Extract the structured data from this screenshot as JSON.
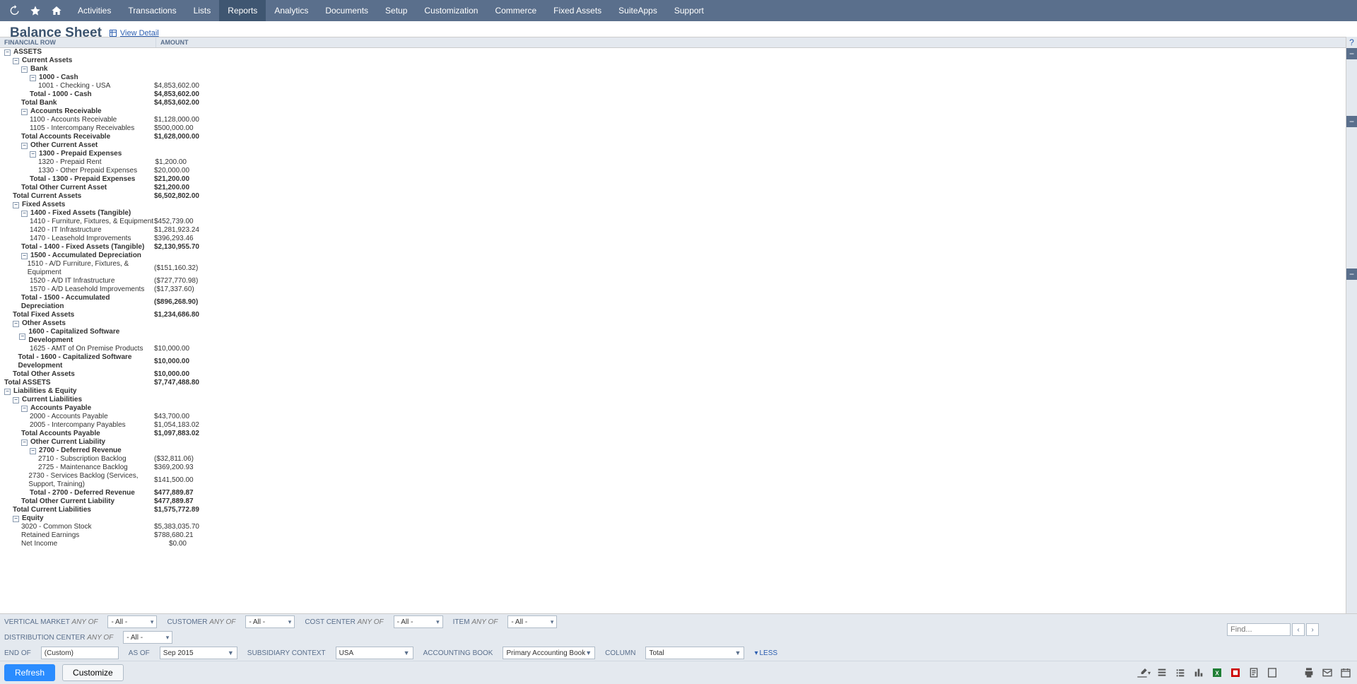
{
  "nav": {
    "items": [
      "Activities",
      "Transactions",
      "Lists",
      "Reports",
      "Analytics",
      "Documents",
      "Setup",
      "Customization",
      "Commerce",
      "Fixed Assets",
      "SuiteApps",
      "Support"
    ],
    "active_index": 3
  },
  "title": {
    "heading": "Balance Sheet",
    "view_detail": "View Detail"
  },
  "columns": {
    "name": "FINANCIAL ROW",
    "amount": "AMOUNT"
  },
  "rows": [
    {
      "depth": 0,
      "toggle": "-",
      "bold": true,
      "label": "ASSETS",
      "amt": ""
    },
    {
      "depth": 1,
      "toggle": "-",
      "bold": true,
      "label": "Current Assets",
      "amt": ""
    },
    {
      "depth": 2,
      "toggle": "-",
      "bold": true,
      "label": "Bank",
      "amt": ""
    },
    {
      "depth": 3,
      "toggle": "-",
      "bold": true,
      "label": "1000 - Cash",
      "amt": ""
    },
    {
      "depth": 4,
      "toggle": "",
      "bold": false,
      "label": "1001 - Checking - USA",
      "amt": "$4,853,602.00"
    },
    {
      "depth": 3,
      "toggle": "",
      "bold": true,
      "label": "Total - 1000 - Cash",
      "amt": "$4,853,602.00"
    },
    {
      "depth": 2,
      "toggle": "",
      "bold": true,
      "label": "Total Bank",
      "amt": "$4,853,602.00"
    },
    {
      "depth": 2,
      "toggle": "-",
      "bold": true,
      "label": "Accounts Receivable",
      "amt": ""
    },
    {
      "depth": 3,
      "toggle": "",
      "bold": false,
      "label": "1100 - Accounts Receivable",
      "amt": "$1,128,000.00"
    },
    {
      "depth": 3,
      "toggle": "",
      "bold": false,
      "label": "1105 - Intercompany Receivables",
      "amt": "$500,000.00"
    },
    {
      "depth": 2,
      "toggle": "",
      "bold": true,
      "label": "Total Accounts Receivable",
      "amt": "$1,628,000.00"
    },
    {
      "depth": 2,
      "toggle": "-",
      "bold": true,
      "label": "Other Current Asset",
      "amt": ""
    },
    {
      "depth": 3,
      "toggle": "-",
      "bold": true,
      "label": "1300 - Prepaid Expenses",
      "amt": ""
    },
    {
      "depth": 4,
      "toggle": "",
      "bold": false,
      "label": "1320 - Prepaid Rent",
      "amt": "$1,200.00"
    },
    {
      "depth": 4,
      "toggle": "",
      "bold": false,
      "label": "1330 - Other Prepaid Expenses",
      "amt": "$20,000.00"
    },
    {
      "depth": 3,
      "toggle": "",
      "bold": true,
      "label": "Total - 1300 - Prepaid Expenses",
      "amt": "$21,200.00"
    },
    {
      "depth": 2,
      "toggle": "",
      "bold": true,
      "label": "Total Other Current Asset",
      "amt": "$21,200.00"
    },
    {
      "depth": 1,
      "toggle": "",
      "bold": true,
      "label": "Total Current Assets",
      "amt": "$6,502,802.00"
    },
    {
      "depth": 1,
      "toggle": "-",
      "bold": true,
      "label": "Fixed Assets",
      "amt": ""
    },
    {
      "depth": 2,
      "toggle": "-",
      "bold": true,
      "label": "1400 - Fixed Assets (Tangible)",
      "amt": ""
    },
    {
      "depth": 3,
      "toggle": "",
      "bold": false,
      "label": "1410 - Furniture, Fixtures, & Equipment",
      "amt": "$452,739.00"
    },
    {
      "depth": 3,
      "toggle": "",
      "bold": false,
      "label": "1420 - IT Infrastructure",
      "amt": "$1,281,923.24"
    },
    {
      "depth": 3,
      "toggle": "",
      "bold": false,
      "label": "1470 - Leasehold Improvements",
      "amt": "$396,293.46"
    },
    {
      "depth": 2,
      "toggle": "",
      "bold": true,
      "label": "Total - 1400 - Fixed Assets (Tangible)",
      "amt": "$2,130,955.70"
    },
    {
      "depth": 2,
      "toggle": "-",
      "bold": true,
      "label": "1500 - Accumulated Depreciation",
      "amt": ""
    },
    {
      "depth": 3,
      "toggle": "",
      "bold": false,
      "label": "1510 - A/D Furniture, Fixtures, & Equipment",
      "amt": "($151,160.32)"
    },
    {
      "depth": 3,
      "toggle": "",
      "bold": false,
      "label": "1520 - A/D IT Infrastructure",
      "amt": "($727,770.98)"
    },
    {
      "depth": 3,
      "toggle": "",
      "bold": false,
      "label": "1570 - A/D Leasehold Improvements",
      "amt": "($17,337.60)"
    },
    {
      "depth": 2,
      "toggle": "",
      "bold": true,
      "label": "Total - 1500 - Accumulated Depreciation",
      "amt": "($896,268.90)"
    },
    {
      "depth": 1,
      "toggle": "",
      "bold": true,
      "label": "Total Fixed Assets",
      "amt": "$1,234,686.80"
    },
    {
      "depth": 1,
      "toggle": "-",
      "bold": true,
      "label": "Other Assets",
      "amt": ""
    },
    {
      "depth": 2,
      "toggle": "-",
      "bold": true,
      "label": "1600 - Capitalized Software Development",
      "amt": ""
    },
    {
      "depth": 3,
      "toggle": "",
      "bold": false,
      "label": "1625 - AMT of On Premise Products",
      "amt": "$10,000.00"
    },
    {
      "depth": 2,
      "toggle": "",
      "bold": true,
      "label": "Total - 1600 - Capitalized Software Development",
      "amt": "$10,000.00"
    },
    {
      "depth": 1,
      "toggle": "",
      "bold": true,
      "label": "Total Other Assets",
      "amt": "$10,000.00"
    },
    {
      "depth": 0,
      "toggle": "",
      "bold": true,
      "label": "Total ASSETS",
      "amt": "$7,747,488.80"
    },
    {
      "depth": 0,
      "toggle": "-",
      "bold": true,
      "label": "Liabilities & Equity",
      "amt": ""
    },
    {
      "depth": 1,
      "toggle": "-",
      "bold": true,
      "label": "Current Liabilities",
      "amt": ""
    },
    {
      "depth": 2,
      "toggle": "-",
      "bold": true,
      "label": "Accounts Payable",
      "amt": ""
    },
    {
      "depth": 3,
      "toggle": "",
      "bold": false,
      "label": "2000 - Accounts Payable",
      "amt": "$43,700.00"
    },
    {
      "depth": 3,
      "toggle": "",
      "bold": false,
      "label": "2005 - Intercompany Payables",
      "amt": "$1,054,183.02"
    },
    {
      "depth": 2,
      "toggle": "",
      "bold": true,
      "label": "Total Accounts Payable",
      "amt": "$1,097,883.02"
    },
    {
      "depth": 2,
      "toggle": "-",
      "bold": true,
      "label": "Other Current Liability",
      "amt": ""
    },
    {
      "depth": 3,
      "toggle": "-",
      "bold": true,
      "label": "2700 - Deferred Revenue",
      "amt": ""
    },
    {
      "depth": 4,
      "toggle": "",
      "bold": false,
      "label": "2710 - Subscription Backlog",
      "amt": "($32,811.06)"
    },
    {
      "depth": 4,
      "toggle": "",
      "bold": false,
      "label": "2725 - Maintenance Backlog",
      "amt": "$369,200.93"
    },
    {
      "depth": 4,
      "toggle": "",
      "bold": false,
      "label": "2730 - Services Backlog (Services, Support, Training)",
      "amt": "$141,500.00"
    },
    {
      "depth": 3,
      "toggle": "",
      "bold": true,
      "label": "Total - 2700 - Deferred Revenue",
      "amt": "$477,889.87"
    },
    {
      "depth": 2,
      "toggle": "",
      "bold": true,
      "label": "Total Other Current Liability",
      "amt": "$477,889.87"
    },
    {
      "depth": 1,
      "toggle": "",
      "bold": true,
      "label": "Total Current Liabilities",
      "amt": "$1,575,772.89"
    },
    {
      "depth": 1,
      "toggle": "-",
      "bold": true,
      "label": "Equity",
      "amt": ""
    },
    {
      "depth": 2,
      "toggle": "",
      "bold": false,
      "label": "3020 - Common Stock",
      "amt": "$5,383,035.70"
    },
    {
      "depth": 2,
      "toggle": "",
      "bold": false,
      "label": "Retained Earnings",
      "amt": "$788,680.21"
    },
    {
      "depth": 2,
      "toggle": "",
      "bold": false,
      "label": "Net Income",
      "amt": "$0.00"
    }
  ],
  "filters": {
    "vertical_market": {
      "label": "VERTICAL MARKET",
      "mod": "ANY OF",
      "val": "- All -"
    },
    "customer": {
      "label": "CUSTOMER",
      "mod": "ANY OF",
      "val": "- All -"
    },
    "cost_center": {
      "label": "COST CENTER",
      "mod": "ANY OF",
      "val": "- All -"
    },
    "item": {
      "label": "ITEM",
      "mod": "ANY OF",
      "val": "- All -"
    },
    "distribution_center": {
      "label": "DISTRIBUTION CENTER",
      "mod": "ANY OF",
      "val": "- All -"
    },
    "end_of": {
      "label": "END OF",
      "val": "(Custom)"
    },
    "as_of": {
      "label": "AS OF",
      "val": "Sep 2015"
    },
    "subsidiary": {
      "label": "SUBSIDIARY CONTEXT",
      "val": "USA"
    },
    "accounting_book": {
      "label": "ACCOUNTING BOOK",
      "val": "Primary Accounting Book"
    },
    "column": {
      "label": "COLUMN",
      "val": "Total"
    },
    "less": "LESS"
  },
  "find": {
    "placeholder": "Find..."
  },
  "buttons": {
    "refresh": "Refresh",
    "customize": "Customize"
  }
}
